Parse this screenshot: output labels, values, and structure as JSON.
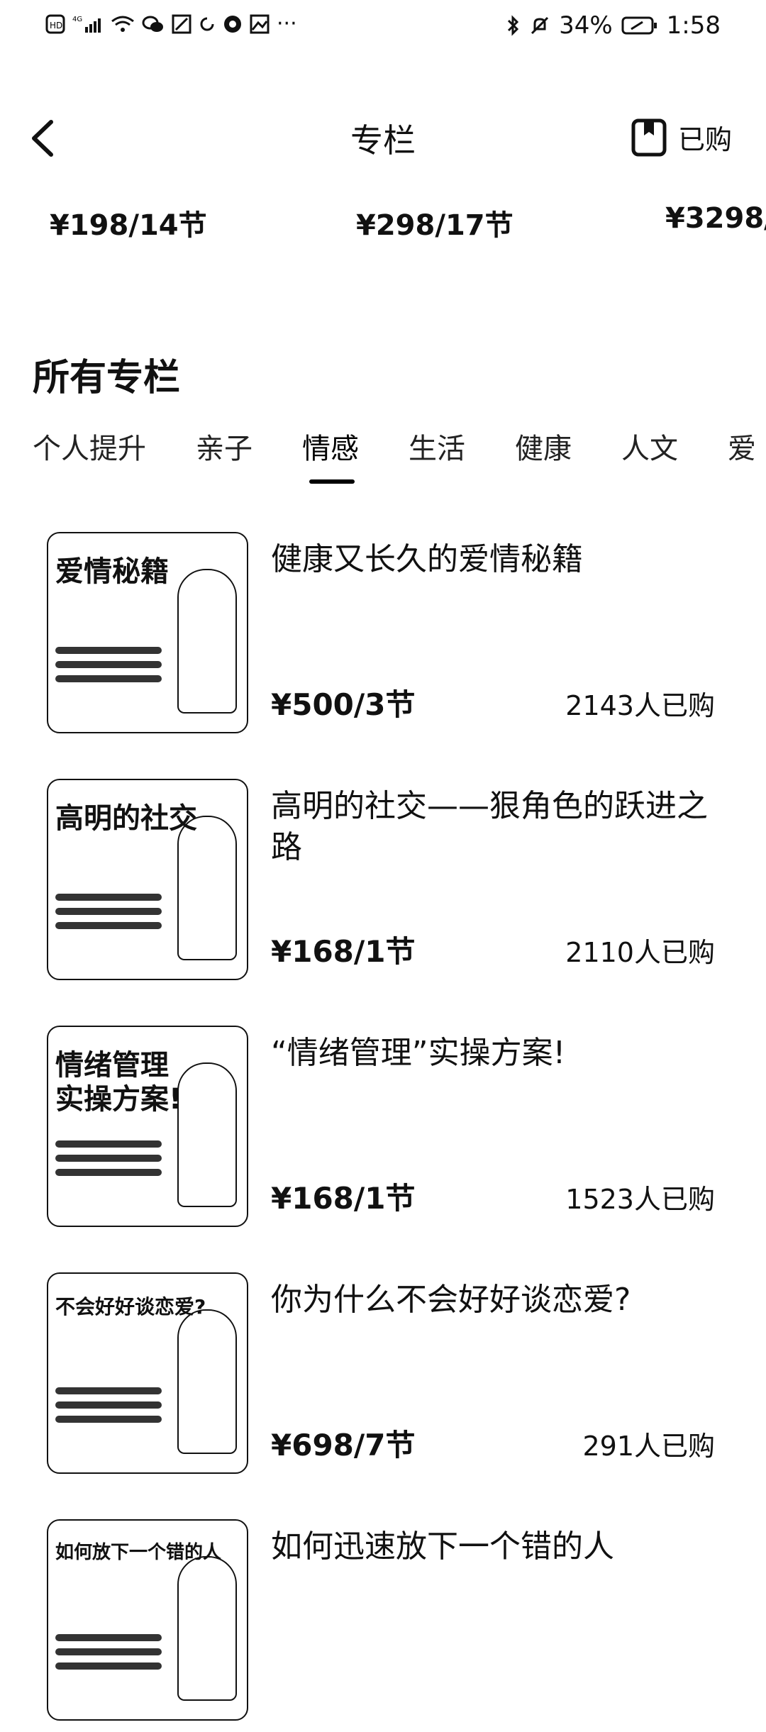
{
  "status_bar": {
    "left_icons": [
      "hd-icon",
      "signal-4g-icon",
      "wifi-icon",
      "wechat-icon",
      "nfc-icon",
      "sync-icon",
      "app-icon",
      "gallery-icon",
      "more-icon"
    ],
    "battery": "34%",
    "time": "1:58"
  },
  "header": {
    "title": "专栏",
    "purchased_label": "已购"
  },
  "prices_strip": [
    "¥198/14节",
    "¥298/17节",
    "¥3298/"
  ],
  "section": {
    "title": "所有专栏"
  },
  "tabs": [
    {
      "label": "个人提升"
    },
    {
      "label": "亲子"
    },
    {
      "label": "情感",
      "active": true
    },
    {
      "label": "生活"
    },
    {
      "label": "健康"
    },
    {
      "label": "人文"
    },
    {
      "label": "爱"
    }
  ],
  "items": [
    {
      "title": "健康又长久的爱情秘籍",
      "price": "¥500/3节",
      "buyers": "2143人已购",
      "cover_text": "爱情秘籍"
    },
    {
      "title": "高明的社交——狠角色的跃进之路",
      "price": "¥168/1节",
      "buyers": "2110人已购",
      "cover_text": "高明的社交"
    },
    {
      "title": "“情绪管理”实操方案!",
      "price": "¥168/1节",
      "buyers": "1523人已购",
      "cover_text": "情绪管理\n实操方案!"
    },
    {
      "title": "你为什么不会好好谈恋爱?",
      "price": "¥698/7节",
      "buyers": "291人已购",
      "cover_text": "不会好好谈恋爱?"
    },
    {
      "title": "如何迅速放下一个错的人",
      "price": "",
      "buyers": "",
      "cover_text": "如何放下一个错的人"
    }
  ]
}
